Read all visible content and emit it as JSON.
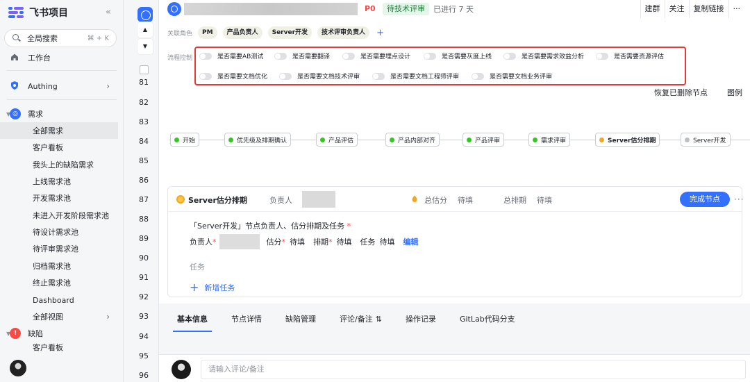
{
  "brand": {
    "title": "飞书项目"
  },
  "sidebar": {
    "search_label": "全局搜索",
    "search_shortcut": "⌘ + K",
    "workbench": "工作台",
    "space_authing": "Authing",
    "group_req": "需求",
    "req_items": [
      "全部需求",
      "客户看板",
      "我头上的缺陷需求",
      "上线需求池",
      "开发需求池",
      "未进入开发阶段需求池",
      "待设计需求池",
      "待评审需求池",
      "归档需求池",
      "终止需求池",
      "Dashboard",
      "全部视图"
    ],
    "group_bug": "缺陷",
    "bug_items": [
      "客户看板"
    ]
  },
  "row_numbers": [
    "81",
    "82",
    "83",
    "84",
    "85",
    "86",
    "87",
    "88",
    "89",
    "90",
    "91",
    "92",
    "93",
    "94",
    "95",
    "96"
  ],
  "header": {
    "priority": "P0",
    "status": "待技术评审",
    "elapsed": "已进行 7 天",
    "actions": [
      "建群",
      "关注",
      "复制链接",
      "···"
    ]
  },
  "roles": {
    "label": "关联角色",
    "chips": [
      "PM",
      "产品负责人",
      "Server开发",
      "技术评审负责人"
    ],
    "add": "+"
  },
  "flow_control": {
    "label": "流程控制",
    "toggles_row1": [
      "是否需要AB测试",
      "是否需要翻译",
      "是否需要埋点设计",
      "是否需要灰度上线",
      "是否需要需求效益分析",
      "是否需要资源评估"
    ],
    "toggles_row2": [
      "是否需要文档优化",
      "是否需要文档技术评审",
      "是否需要文档工程师评审",
      "是否需要文档业务评审"
    ]
  },
  "links": {
    "restore": "恢复已删除节点",
    "legend": "图例"
  },
  "pipeline": [
    {
      "label": "开始",
      "status": "done"
    },
    {
      "label": "优先级及排期确认",
      "status": "done"
    },
    {
      "label": "产品评估",
      "status": "done"
    },
    {
      "label": "产品内部对齐",
      "status": "done"
    },
    {
      "label": "产品评审",
      "status": "done"
    },
    {
      "label": "需求评审",
      "status": "done"
    },
    {
      "label": "Server估分排期",
      "status": "current"
    },
    {
      "label": "Server开发",
      "status": "pending"
    }
  ],
  "node_card": {
    "title": "Server估分排期",
    "owner_label": "负责人",
    "est_label": "总估分",
    "est_value": "待填",
    "sched_label": "总排期",
    "sched_value": "待填",
    "complete": "完成节点",
    "more": "···",
    "subtitle": "「Server开发」节点负责人、估分排期及任务",
    "required": "*",
    "f_owner": "负责人",
    "f_est": "估分",
    "f_est_val": "待填",
    "f_sched": "排期",
    "f_sched_val": "待填",
    "f_task": "任务",
    "f_task_val": "待填",
    "edit": "编辑",
    "tasks_label": "任务",
    "add_task": "新增任务"
  },
  "tabs": [
    "基本信息",
    "节点详情",
    "缺陷管理",
    "评论/备注",
    "操作记录",
    "GitLab代码分支"
  ],
  "comment": {
    "placeholder": "请输入评论/备注"
  },
  "colors": {
    "accent": "#3370ff",
    "done": "#34c724",
    "current": "#f5a623",
    "pending": "#bbbfc4",
    "alert": "#e53935"
  }
}
